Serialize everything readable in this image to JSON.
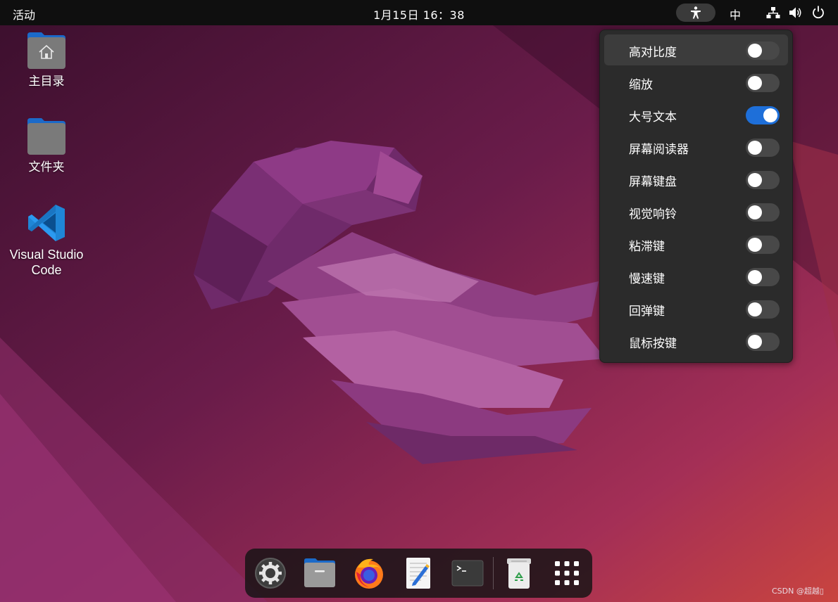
{
  "topbar": {
    "activities": "活动",
    "clock": "1月15日  16：38",
    "input_method": "中"
  },
  "desktop": {
    "icons": [
      {
        "label": "主目录",
        "icon": "home-folder-icon"
      },
      {
        "label": "文件夹",
        "icon": "folder-icon"
      },
      {
        "label_line1": "Visual Studio",
        "label_line2": "Code",
        "icon": "vscode-icon"
      }
    ]
  },
  "accessibility_menu": {
    "items": [
      {
        "label": "高对比度",
        "enabled": false
      },
      {
        "label": "缩放",
        "enabled": false
      },
      {
        "label": "大号文本",
        "enabled": true
      },
      {
        "label": "屏幕阅读器",
        "enabled": false
      },
      {
        "label": "屏幕键盘",
        "enabled": false
      },
      {
        "label": "视觉响铃",
        "enabled": false
      },
      {
        "label": "粘滞键",
        "enabled": false
      },
      {
        "label": "慢速键",
        "enabled": false
      },
      {
        "label": "回弹键",
        "enabled": false
      },
      {
        "label": "鼠标按键",
        "enabled": false
      }
    ]
  },
  "dock": {
    "items": [
      "settings-icon",
      "files-icon",
      "firefox-icon",
      "text-editor-icon",
      "terminal-icon",
      "trash-icon",
      "app-grid-icon"
    ]
  },
  "watermark": "CSDN @超越▯",
  "colors": {
    "toggle_on": "#1e6fd9",
    "toggle_off": "#484848",
    "menu_bg": "#2b2b2b",
    "topbar_bg": "#0f0f0f"
  }
}
